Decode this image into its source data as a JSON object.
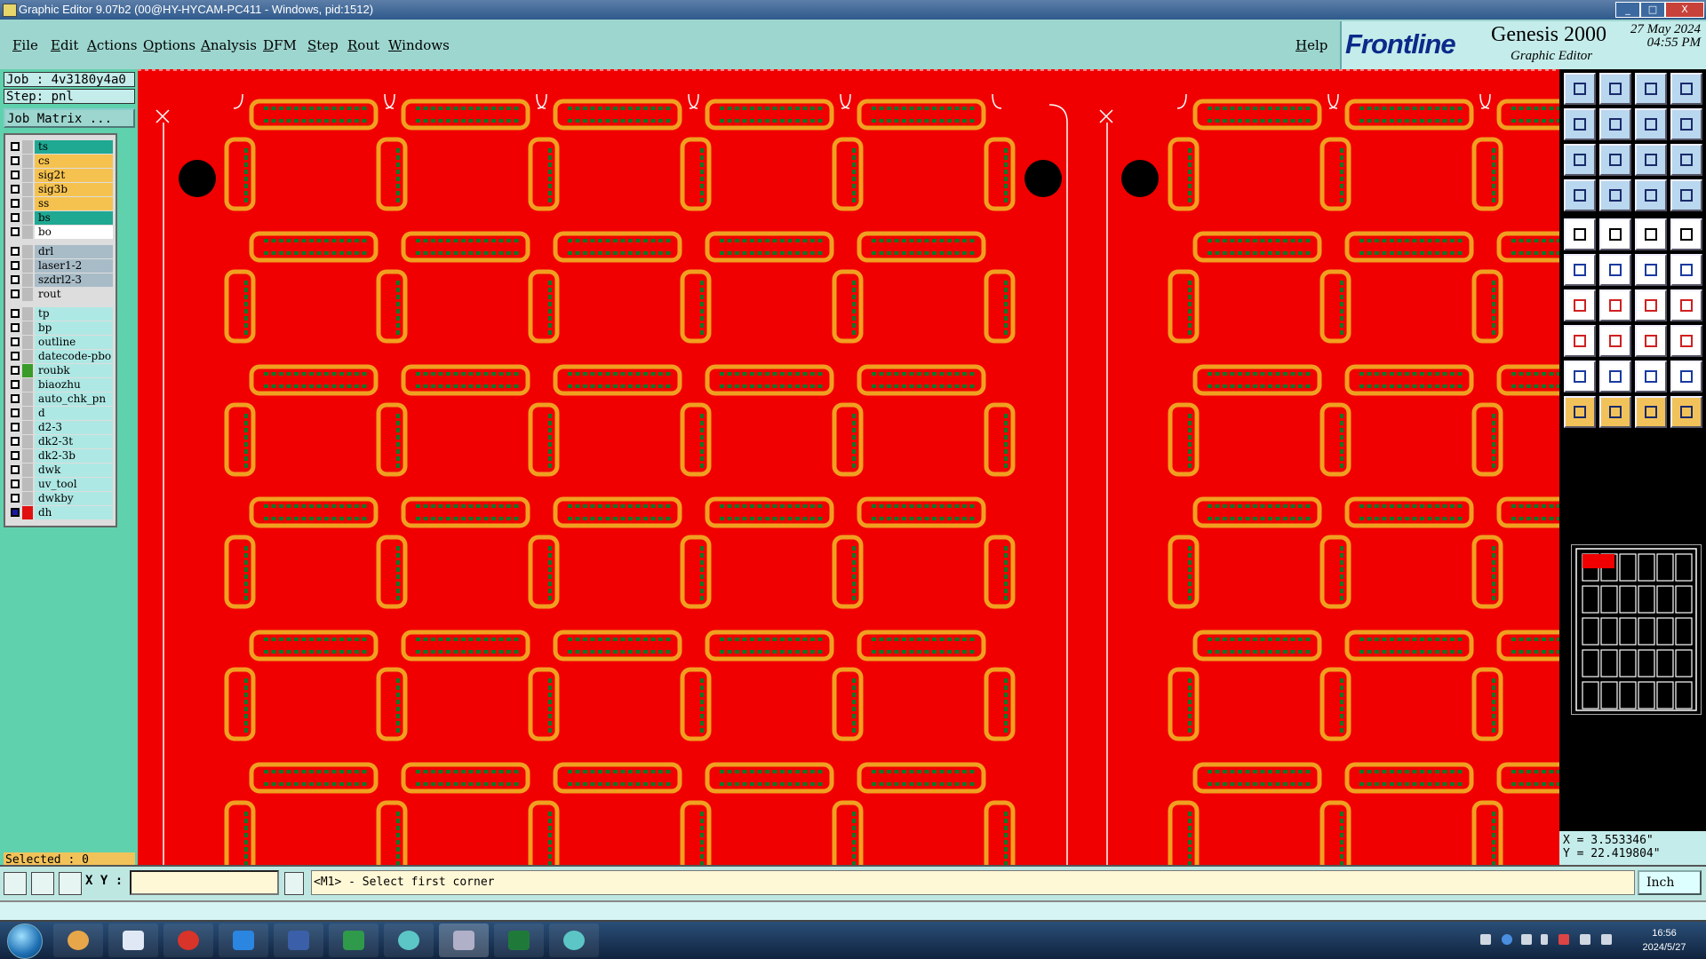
{
  "window": {
    "title": "Graphic Editor 9.07b2 (00@HY-HYCAM-PC411 - Windows, pid:1512)",
    "controls": [
      "_",
      "□",
      "X"
    ]
  },
  "menu": {
    "items": [
      "File",
      "Edit",
      "Actions",
      "Options",
      "Analysis",
      "DFM",
      "Step",
      "Rout",
      "Windows"
    ],
    "help": "Help"
  },
  "brand": {
    "logo": "Frontline",
    "product": "Genesis 2000",
    "subtitle": "Graphic Editor",
    "date": "27 May 2024",
    "time": "04:55 PM"
  },
  "job": {
    "job_label": "Job : 4v3180y4a0",
    "step_label": "Step: pnl",
    "matrix_button": "Job Matrix ..."
  },
  "layers": [
    {
      "name": "ts",
      "color": "#1fa892"
    },
    {
      "name": "cs",
      "color": "#f5c24f"
    },
    {
      "name": "sig2t",
      "color": "#f5c24f"
    },
    {
      "name": "sig3b",
      "color": "#f5c24f"
    },
    {
      "name": "ss",
      "color": "#f5c24f"
    },
    {
      "name": "bs",
      "color": "#1fa892"
    },
    {
      "name": "bo",
      "color": "#ffffff"
    },
    {
      "name": "drl",
      "color": "#a8bcc8"
    },
    {
      "name": "laser1-2",
      "color": "#a8bcc8"
    },
    {
      "name": "szdrl2-3",
      "color": "#a8bcc8"
    },
    {
      "name": "rout",
      "color": "#dddddd"
    },
    {
      "name": "tp",
      "color": "#aee8e4"
    },
    {
      "name": "bp",
      "color": "#aee8e4"
    },
    {
      "name": "outline",
      "color": "#aee8e4"
    },
    {
      "name": "datecode-pbo",
      "color": "#aee8e4"
    },
    {
      "name": "roubk",
      "color": "#aee8e4"
    },
    {
      "name": "biaozhu",
      "color": "#aee8e4"
    },
    {
      "name": "auto_chk_pn",
      "color": "#aee8e4"
    },
    {
      "name": "d",
      "color": "#aee8e4"
    },
    {
      "name": "d2-3",
      "color": "#aee8e4"
    },
    {
      "name": "dk2-3t",
      "color": "#aee8e4"
    },
    {
      "name": "dk2-3b",
      "color": "#aee8e4"
    },
    {
      "name": "dwk",
      "color": "#aee8e4"
    },
    {
      "name": "uv_tool",
      "color": "#aee8e4"
    },
    {
      "name": "dwkby",
      "color": "#aee8e4"
    },
    {
      "name": "dh",
      "color": "#aee8e4"
    }
  ],
  "selected": "Selected : 0",
  "coordinates": {
    "x": "X = 3.553346\"",
    "y": "Y = 22.419804\""
  },
  "command": {
    "xy_label": "X Y :",
    "xy_value": "",
    "prompt": "<M1> - Select first corner",
    "unit": "Inch"
  },
  "taskbar": {
    "time": "16:56",
    "date": "2024/5/27"
  },
  "colors": {
    "canvas": "#f00000",
    "pad_outline": "#f0a020",
    "drill": "#0a7a2a"
  }
}
